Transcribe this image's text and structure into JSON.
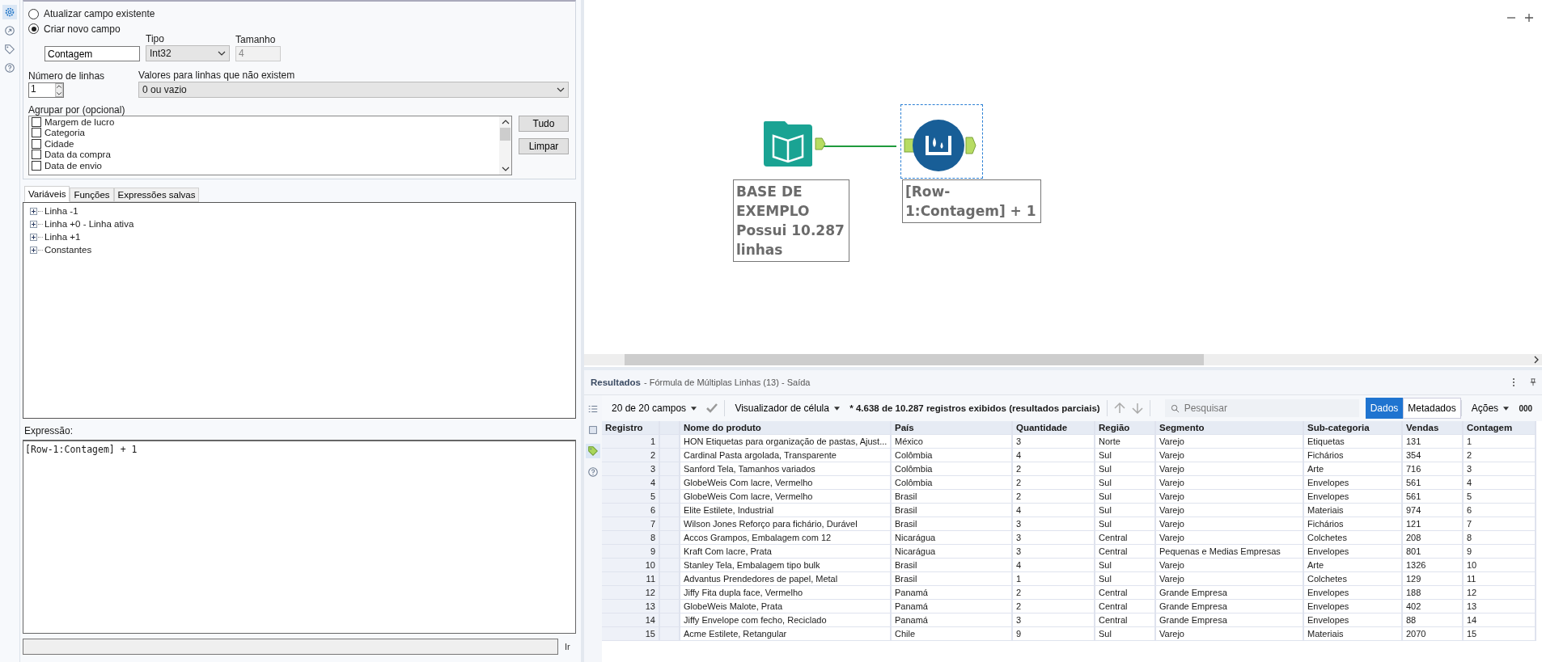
{
  "sidebar_icons": [
    {
      "kind": "gear",
      "selected": true
    },
    {
      "kind": "exit",
      "selected": false
    },
    {
      "kind": "tag",
      "selected": false
    },
    {
      "kind": "help",
      "selected": false
    }
  ],
  "config": {
    "mode_options": [
      {
        "label": "Atualizar campo existente",
        "selected": false
      },
      {
        "label": "Criar novo campo",
        "selected": true
      }
    ],
    "new_field": {
      "name": "Contagem",
      "type_label": "Tipo",
      "type": "Int32",
      "size_label": "Tamanho",
      "size": "4"
    },
    "rows": {
      "label": "Número de linhas",
      "value": "1"
    },
    "missing": {
      "label": "Valores para linhas que não existem",
      "value": "0 ou vazio"
    },
    "group_by": {
      "label": "Agrupar por (opcional)",
      "items": [
        {
          "label": "Margem de lucro",
          "checked": false
        },
        {
          "label": "Categoria",
          "checked": false
        },
        {
          "label": "Cidade",
          "checked": false
        },
        {
          "label": "Data da compra",
          "checked": false
        },
        {
          "label": "Data de envio",
          "checked": false
        }
      ]
    },
    "buttons": [
      "Tudo",
      "Limpar"
    ]
  },
  "tabs": [
    {
      "label": "Variáveis",
      "selected": true
    },
    {
      "label": "Funções",
      "selected": false
    },
    {
      "label": "Expressões salvas",
      "selected": false
    }
  ],
  "tree": [
    {
      "label": "Linha -1",
      "expanded": false
    },
    {
      "label": "Linha +0 - Linha ativa",
      "expanded": false
    },
    {
      "label": "Linha +1",
      "expanded": false
    },
    {
      "label": "Constantes",
      "expanded": false
    }
  ],
  "expression": {
    "label": "Expressão:",
    "value": "[Row-1:Contagem] + 1"
  },
  "bottom_link": "Ir",
  "canvas": {
    "nodes": [
      {
        "kind": "input",
        "label": "BASE DE EXEMPLO Possui 10.287 linhas",
        "selected": false
      },
      {
        "kind": "formula",
        "label": "[Row-1:Contagem] + 1",
        "selected": true
      }
    ]
  },
  "results": {
    "title": "Resultados",
    "subtitle": "- Fórmula de Múltiplas Linhas (13) - Saída",
    "side_icons": [
      {
        "kind": "list",
        "selected": false
      },
      {
        "kind": "panel",
        "selected": false
      },
      {
        "kind": "tag",
        "selected": true
      },
      {
        "kind": "help",
        "selected": false
      }
    ],
    "fields": "20 de 20 campos",
    "viewer": "Visualizador de célula",
    "status": "* 4.638 de 10.287 registros exibidos (resultados parciais)",
    "search": {
      "placeholder": "Pesquisar"
    },
    "view_tabs": [
      {
        "label": "Dados",
        "selected": true
      },
      {
        "label": "Metadados",
        "selected": false
      }
    ],
    "actions": "Ações",
    "more": "000",
    "table": {
      "columns": [
        "Registro",
        "",
        "Nome do produto",
        "País",
        "Quantidade",
        "Região",
        "Segmento",
        "Sub-categoria",
        "Vendas",
        "Contagem"
      ],
      "rows": [
        [
          "1",
          "",
          "HON Etiquetas para organização de pastas, Ajust...",
          "México",
          "3",
          "Norte",
          "Varejo",
          "Etiquetas",
          "131",
          "1"
        ],
        [
          "2",
          "",
          "Cardinal Pasta argolada, Transparente",
          "Colômbia",
          "4",
          "Sul",
          "Varejo",
          "Fichários",
          "354",
          "2"
        ],
        [
          "3",
          "",
          "Sanford Tela, Tamanhos variados",
          "Colômbia",
          "2",
          "Sul",
          "Varejo",
          "Arte",
          "716",
          "3"
        ],
        [
          "4",
          "",
          "GlobeWeis Com lacre, Vermelho",
          "Colômbia",
          "2",
          "Sul",
          "Varejo",
          "Envelopes",
          "561",
          "4"
        ],
        [
          "5",
          "",
          "GlobeWeis Com lacre, Vermelho",
          "Brasil",
          "2",
          "Sul",
          "Varejo",
          "Envelopes",
          "561",
          "5"
        ],
        [
          "6",
          "",
          "Elite Estilete, Industrial",
          "Brasil",
          "4",
          "Sul",
          "Varejo",
          "Materiais",
          "974",
          "6"
        ],
        [
          "7",
          "",
          "Wilson Jones Reforço para fichário, Durável",
          "Brasil",
          "3",
          "Sul",
          "Varejo",
          "Fichários",
          "121",
          "7"
        ],
        [
          "8",
          "",
          "Accos Grampos, Embalagem com 12",
          "Nicarágua",
          "3",
          "Central",
          "Varejo",
          "Colchetes",
          "208",
          "8"
        ],
        [
          "9",
          "",
          "Kraft Com lacre, Prata",
          "Nicarágua",
          "3",
          "Central",
          "Pequenas e Medias Empresas",
          "Envelopes",
          "801",
          "9"
        ],
        [
          "10",
          "",
          "Stanley Tela, Embalagem tipo bulk",
          "Brasil",
          "4",
          "Sul",
          "Varejo",
          "Arte",
          "1326",
          "10"
        ],
        [
          "11",
          "",
          "Advantus Prendedores de papel, Metal",
          "Brasil",
          "1",
          "Sul",
          "Varejo",
          "Colchetes",
          "129",
          "11"
        ],
        [
          "12",
          "",
          "Jiffy Fita dupla face, Vermelho",
          "Panamá",
          "2",
          "Central",
          "Grande Empresa",
          "Envelopes",
          "188",
          "12"
        ],
        [
          "13",
          "",
          "GlobeWeis Malote, Prata",
          "Panamá",
          "2",
          "Central",
          "Grande Empresa",
          "Envelopes",
          "402",
          "13"
        ],
        [
          "14",
          "",
          "Jiffy Envelope com fecho, Reciclado",
          "Panamá",
          "3",
          "Central",
          "Grande Empresa",
          "Envelopes",
          "88",
          "14"
        ],
        [
          "15",
          "",
          "Acme Estilete, Retangular",
          "Chile",
          "9",
          "Sul",
          "Varejo",
          "Materiais",
          "2070",
          "15"
        ]
      ]
    }
  }
}
